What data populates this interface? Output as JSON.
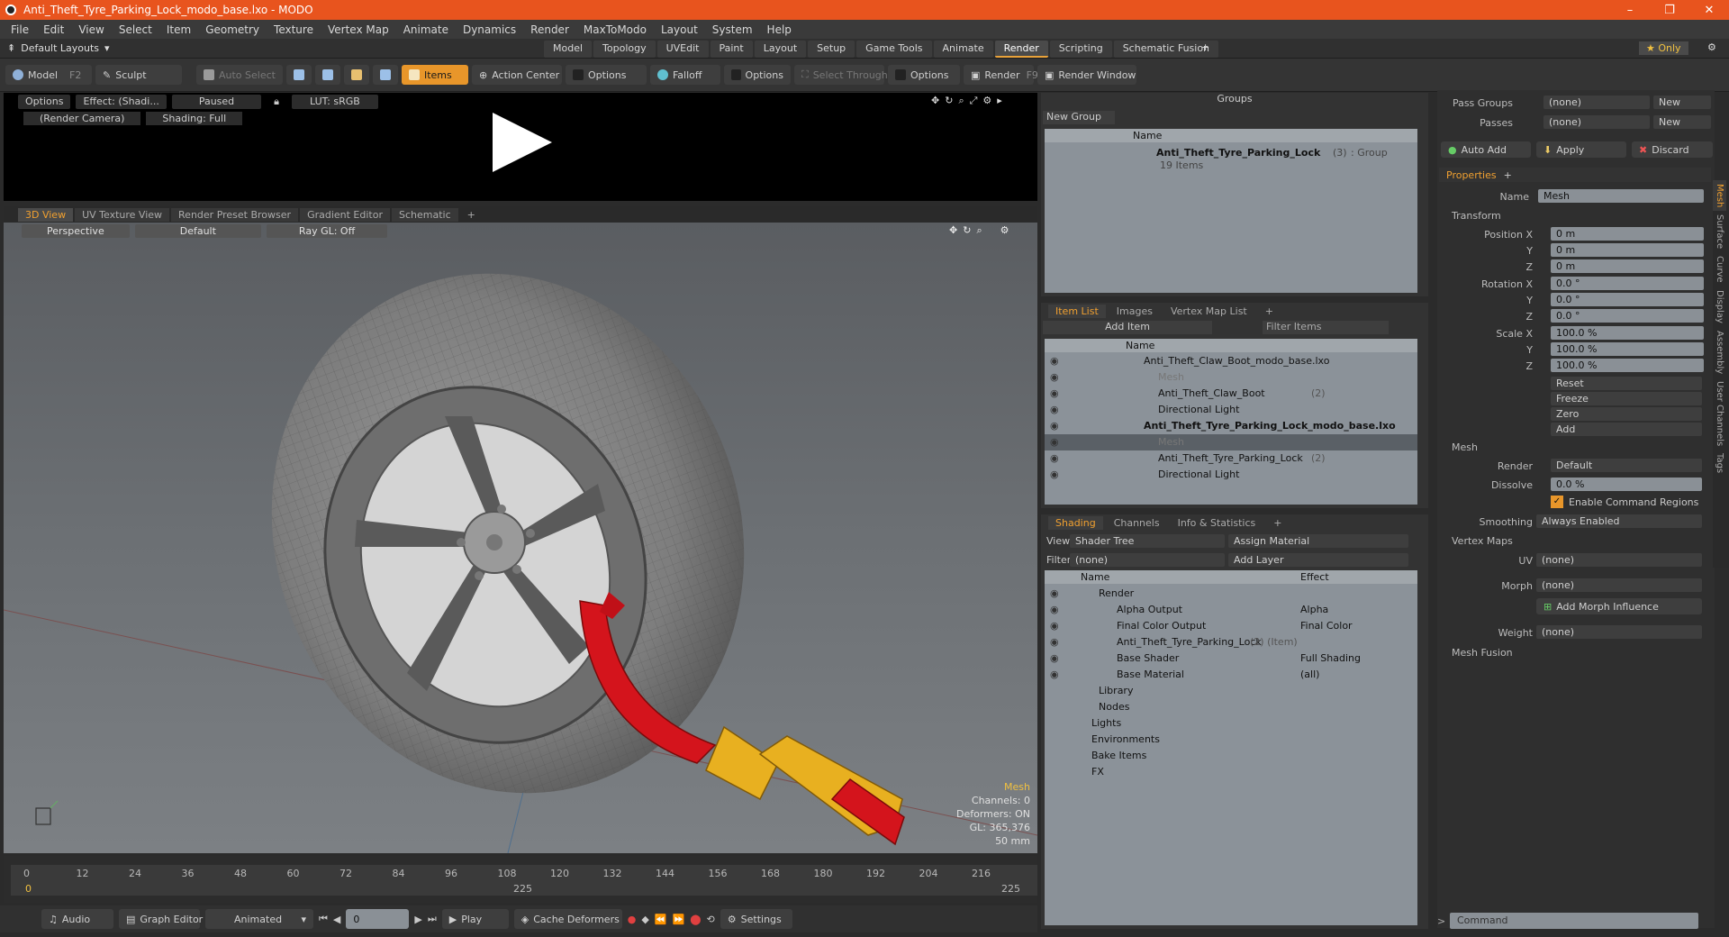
{
  "app": {
    "title": "Anti_Theft_Tyre_Parking_Lock_modo_base.lxo - MODO"
  },
  "menu": [
    "File",
    "Edit",
    "View",
    "Select",
    "Item",
    "Geometry",
    "Texture",
    "Vertex Map",
    "Animate",
    "Dynamics",
    "Render",
    "MaxToModo",
    "Layout",
    "System",
    "Help"
  ],
  "layouts": {
    "default_label": "Default Layouts",
    "tabs": [
      "Model",
      "Topology",
      "UVEdit",
      "Paint",
      "Layout",
      "Setup",
      "Game Tools",
      "Animate",
      "Render",
      "Scripting",
      "Schematic Fusion"
    ],
    "active_tab": "Render",
    "only_label": "Only"
  },
  "toolbar": {
    "model": "Model",
    "model_key": "F2",
    "sculpt": "Sculpt",
    "auto_select": "Auto Select",
    "items": "Items",
    "action_center": "Action Center",
    "options1": "Options",
    "falloff": "Falloff",
    "options2": "Options",
    "select_through": "Select Through",
    "options3": "Options",
    "render": "Render",
    "render_key": "F9",
    "render_window": "Render Window"
  },
  "preview": {
    "options": "Options",
    "effect": "Effect: (Shadi...",
    "paused": "Paused",
    "lut": "LUT: sRGB",
    "camera": "(Render Camera)",
    "shading": "Shading: Full"
  },
  "viewport_tabs": [
    "3D View",
    "UV Texture View",
    "Render Preset Browser",
    "Gradient Editor",
    "Schematic"
  ],
  "viewport": {
    "perspective": "Perspective",
    "default": "Default",
    "raygl": "Ray GL: Off",
    "info": {
      "mesh": "Mesh",
      "channels": "Channels: 0",
      "deformers": "Deformers: ON",
      "gl": "GL: 365,376",
      "size": "50 mm"
    }
  },
  "timeline": {
    "ticks": [
      "0",
      "12",
      "24",
      "36",
      "48",
      "60",
      "72",
      "84",
      "96",
      "108",
      "120",
      "132",
      "144",
      "156",
      "168",
      "180",
      "192",
      "204",
      "216"
    ],
    "start": "0",
    "mid": "225",
    "end": "225"
  },
  "bottombar": {
    "audio": "Audio",
    "graph_editor": "Graph Editor",
    "animated": "Animated",
    "frame": "0",
    "play": "Play",
    "cache": "Cache Deformers",
    "settings": "Settings"
  },
  "groups": {
    "title": "Groups",
    "new_group": "New Group",
    "col_name": "Name",
    "group_name": "Anti_Theft_Tyre_Parking_Lock",
    "group_count": "(3)",
    "group_type": ": Group",
    "group_items": "19 Items"
  },
  "itemlist": {
    "tabs": [
      "Item List",
      "Images",
      "Vertex Map List"
    ],
    "add_item": "Add Item",
    "filter": "Filter Items",
    "col_name": "Name",
    "rows": [
      {
        "label": "Anti_Theft_Claw_Boot_modo_base.lxo",
        "bold": false,
        "indent": 0
      },
      {
        "label": "Mesh",
        "bold": false,
        "indent": 2,
        "dim": true
      },
      {
        "label": "Anti_Theft_Claw_Boot",
        "extra": "(2)",
        "indent": 2
      },
      {
        "label": "Directional Light",
        "indent": 2
      },
      {
        "label": "Anti_Theft_Tyre_Parking_Lock_modo_base.lxo",
        "bold": true,
        "indent": 0
      },
      {
        "label": "Mesh",
        "indent": 2,
        "dim": true,
        "selected": true
      },
      {
        "label": "Anti_Theft_Tyre_Parking_Lock",
        "extra": "(2)",
        "indent": 2
      },
      {
        "label": "Directional Light",
        "indent": 2
      }
    ]
  },
  "shading": {
    "tabs": [
      "Shading",
      "Channels",
      "Info & Statistics"
    ],
    "view_label": "View",
    "view_value": "Shader Tree",
    "assign": "Assign Material",
    "filter_label": "Filter",
    "filter_value": "(none)",
    "add_layer": "Add Layer",
    "col_name": "Name",
    "col_effect": "Effect",
    "rows": [
      {
        "label": "Render",
        "effect": "",
        "indent": 0
      },
      {
        "label": "Alpha Output",
        "effect": "Alpha",
        "indent": 1
      },
      {
        "label": "Final Color Output",
        "effect": "Final Color",
        "indent": 1
      },
      {
        "label": "Anti_Theft_Tyre_Parking_Lock",
        "extra": "(2) (Item)",
        "effect": "",
        "indent": 1
      },
      {
        "label": "Base Shader",
        "effect": "Full Shading",
        "indent": 1
      },
      {
        "label": "Base Material",
        "effect": "(all)",
        "indent": 1
      },
      {
        "label": "Library",
        "effect": "",
        "indent": 0
      },
      {
        "label": "Nodes",
        "effect": "",
        "indent": 0
      },
      {
        "label": "Lights",
        "effect": "",
        "indent": -1
      },
      {
        "label": "Environments",
        "effect": "",
        "indent": -1
      },
      {
        "label": "Bake Items",
        "effect": "",
        "indent": -1
      },
      {
        "label": "FX",
        "effect": "",
        "indent": -1
      }
    ]
  },
  "props": {
    "pass_groups": "Pass Groups",
    "passes": "Passes",
    "none": "(none)",
    "new": "New",
    "auto_add": "Auto Add",
    "apply": "Apply",
    "discard": "Discard",
    "tab": "Properties",
    "name_label": "Name",
    "name_value": "Mesh",
    "transform": "Transform",
    "position_x": "Position X",
    "rotation_x": "Rotation X",
    "scale_x": "Scale X",
    "y": "Y",
    "z": "Z",
    "pos": [
      "0 m",
      "0 m",
      "0 m"
    ],
    "rot": [
      "0.0 °",
      "0.0 °",
      "0.0 °"
    ],
    "scl": [
      "100.0 %",
      "100.0 %",
      "100.0 %"
    ],
    "reset": "Reset",
    "freeze": "Freeze",
    "zero": "Zero",
    "add": "Add",
    "mesh": "Mesh",
    "render_label": "Render",
    "render_value": "Default",
    "dissolve_label": "Dissolve",
    "dissolve_value": "0.0 %",
    "enable_cmd": "Enable Command Regions",
    "smoothing_label": "Smoothing",
    "smoothing_value": "Always Enabled",
    "vertex_maps": "Vertex Maps",
    "uv_label": "UV",
    "morph_label": "Morph",
    "add_morph": "Add Morph Influence",
    "weight_label": "Weight",
    "mesh_fusion": "Mesh Fusion",
    "command": "Command",
    "side_tabs": [
      "Mesh",
      "Surface",
      "Curve",
      "Display",
      "Assembly",
      "User Channels",
      "Tags"
    ]
  }
}
